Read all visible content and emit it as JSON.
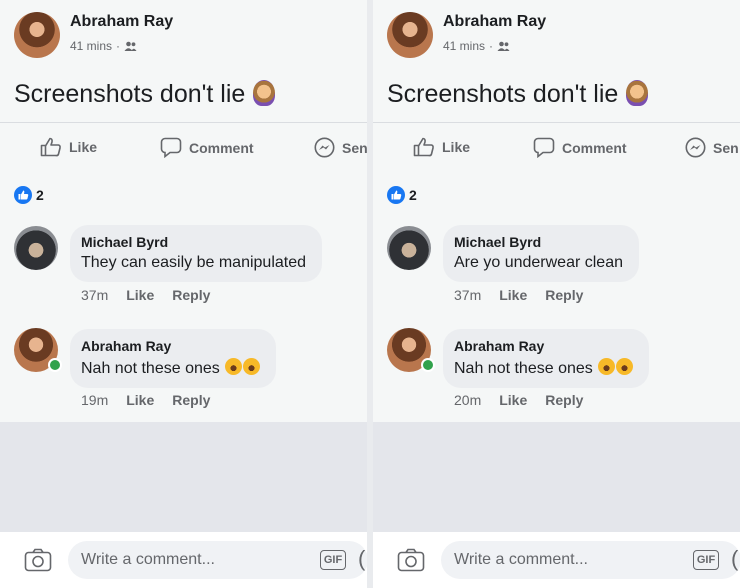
{
  "panels": [
    {
      "post": {
        "author": "Abraham Ray",
        "time": "41 mins",
        "separator": "·",
        "text": "Screenshots don't lie",
        "actions": {
          "like": "Like",
          "comment": "Comment",
          "send": "Sen"
        },
        "reaction_count": "2"
      },
      "comments": [
        {
          "author": "Michael Byrd",
          "text": "They can easily be manipulated",
          "time": "37m",
          "like": "Like",
          "reply": "Reply"
        },
        {
          "author": "Abraham Ray",
          "text": "Nah not these ones",
          "time": "19m",
          "like": "Like",
          "reply": "Reply"
        }
      ],
      "composer": {
        "placeholder": "Write a comment...",
        "gif": "GIF"
      }
    },
    {
      "post": {
        "author": "Abraham Ray",
        "time": "41 mins",
        "separator": "·",
        "text": "Screenshots don't lie",
        "actions": {
          "like": "Like",
          "comment": "Comment",
          "send": "Sen"
        },
        "reaction_count": "2"
      },
      "comments": [
        {
          "author": "Michael Byrd",
          "text": "Are yo underwear clean",
          "time": "37m",
          "like": "Like",
          "reply": "Reply"
        },
        {
          "author": "Abraham Ray",
          "text": "Nah not these ones",
          "time": "20m",
          "like": "Like",
          "reply": "Reply"
        }
      ],
      "composer": {
        "placeholder": "Write a comment...",
        "gif": "GIF"
      }
    }
  ],
  "colors": {
    "accent": "#1877f2",
    "online": "#31a24c",
    "secondary_text": "#65676b",
    "bubble": "#ebedf0"
  }
}
